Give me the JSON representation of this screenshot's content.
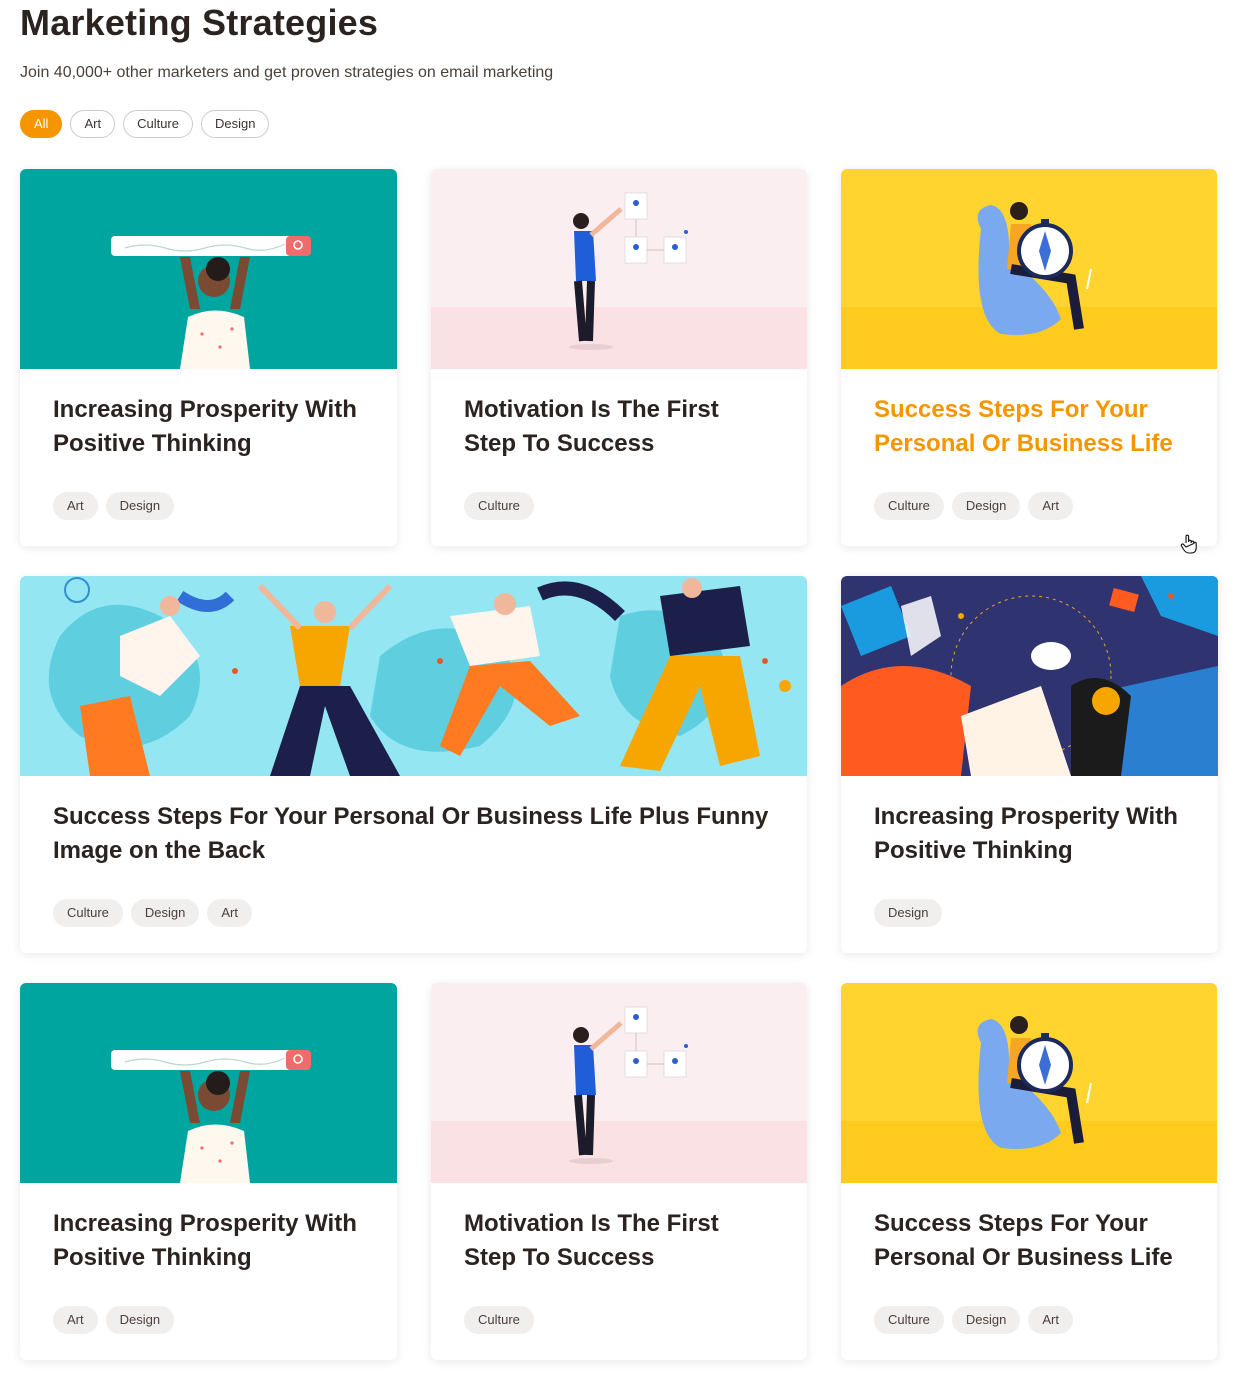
{
  "header": {
    "title": "Marketing Strategies",
    "subtitle": "Join 40,000+ other marketers and get proven strategies on email marketing"
  },
  "filters": [
    "All",
    "Art",
    "Culture",
    "Design"
  ],
  "active_filter": "All",
  "colors": {
    "accent": "#f59500",
    "teal": "#00a5a0",
    "pink": "#fbe7e9",
    "yellow": "#ffd22e",
    "sky": "#94e6f3",
    "navy": "#2f3471"
  },
  "cards": [
    {
      "title": "Increasing Prosperity With Positive Thinking",
      "tags": [
        "Art",
        "Design"
      ],
      "image": "search-bar-illustration"
    },
    {
      "title": "Motivation Is The First Step To Success",
      "tags": [
        "Culture"
      ],
      "image": "flowchart-illustration"
    },
    {
      "title": "Success Steps For Your Personal Or Business Life",
      "tags": [
        "Culture",
        "Design",
        "Art"
      ],
      "image": "compass-illustration"
    },
    {
      "title": "Success Steps For Your Personal Or Business Life Plus Funny Image on the Back",
      "tags": [
        "Culture",
        "Design",
        "Art"
      ],
      "image": "dancing-people-illustration"
    },
    {
      "title": "Increasing Prosperity With Positive Thinking",
      "tags": [
        "Design"
      ],
      "image": "collage-illustration"
    },
    {
      "title": "Increasing Prosperity With Positive Thinking",
      "tags": [
        "Art",
        "Design"
      ],
      "image": "search-bar-illustration"
    },
    {
      "title": "Motivation Is The First Step To Success",
      "tags": [
        "Culture"
      ],
      "image": "flowchart-illustration"
    },
    {
      "title": "Success Steps For Your Personal Or Business Life",
      "tags": [
        "Culture",
        "Design",
        "Art"
      ],
      "image": "compass-illustration"
    }
  ]
}
